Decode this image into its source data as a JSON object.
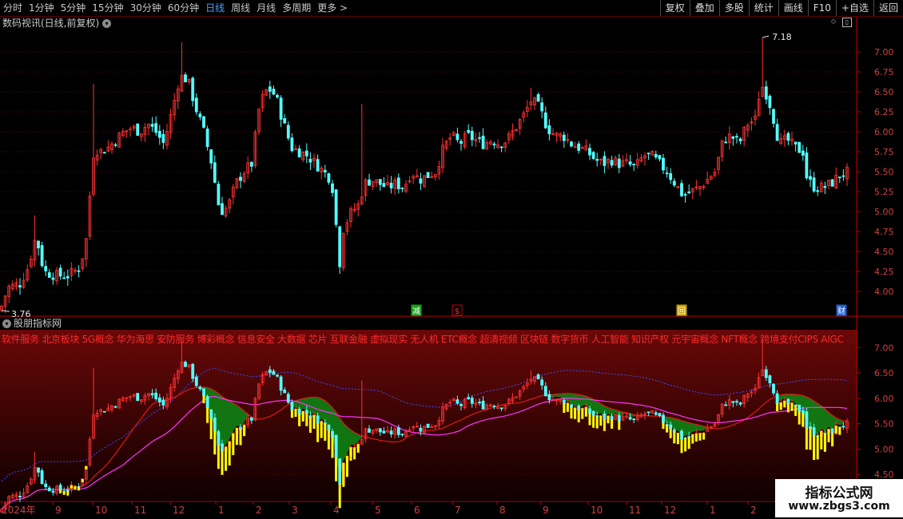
{
  "toolbar": {
    "periods": [
      "分时",
      "1分钟",
      "5分钟",
      "15分钟",
      "30分钟",
      "60分钟",
      "日线",
      "周线",
      "月线",
      "多周期",
      "更多 >"
    ],
    "active_period": "日线",
    "tools": [
      "复权",
      "叠加",
      "多股",
      "统计",
      "画线",
      "F10",
      "+自选",
      "返回"
    ]
  },
  "panel1": {
    "title": "数码视讯(日线,前复权)",
    "high_label": "7.18",
    "low_label": "3.76",
    "event_markers": [
      "减",
      "$",
      "回",
      "财"
    ]
  },
  "panel2": {
    "title": "股朋指标网",
    "concepts": "软件服务 北京板块 5G概念 华为海思 安防服务 博彩概念 信息安全 大数据 芯片 互联金融 虚拟现实 无人机 ETC概念 超清视频 区块链 数字货币 人工智能 知识产权 元宇宙概念 NFT概念 跨境支付CIPS AIGC"
  },
  "watermark": {
    "line1": "指标公式网",
    "line2": "www.zbgs3.com"
  },
  "colors": {
    "up": "#ff3232",
    "down": "#54ffff",
    "ma_red": "#dd1818",
    "ma_magenta": "#ff33ff",
    "upper_band": "#3a4cff",
    "green_fill": "#0a8a14",
    "yellow": "#ffff00",
    "grid": "#6e0000",
    "axis": "#c00000"
  },
  "chart_data": {
    "type": "candlestick",
    "price_axis_top": {
      "ticks": [
        "7.00",
        "6.75",
        "6.50",
        "6.25",
        "6.00",
        "5.75",
        "5.50",
        "5.25",
        "5.00",
        "4.75",
        "4.50",
        "4.25",
        "4.00"
      ],
      "ylim": [
        3.72,
        7.25
      ]
    },
    "price_axis_bottom": {
      "ticks": [
        "7.00",
        "6.50",
        "6.00",
        "5.50",
        "5.00",
        "4.50"
      ],
      "ylim": [
        4.0,
        7.35
      ]
    },
    "time_axis": {
      "labels": [
        "2024年",
        "9",
        "10",
        "11",
        "12",
        "1",
        "2",
        "3",
        "4",
        "5",
        "6",
        "7",
        "8",
        "9",
        "10",
        "11",
        "12",
        "1",
        "2"
      ]
    },
    "close_path": [
      [
        0,
        3.76
      ],
      [
        10,
        4.05
      ],
      [
        25,
        4.1
      ],
      [
        35,
        4.3
      ],
      [
        45,
        4.7
      ],
      [
        55,
        4.25
      ],
      [
        70,
        4.2
      ],
      [
        85,
        4.2
      ],
      [
        100,
        4.3
      ],
      [
        110,
        4.75
      ],
      [
        114,
        5.5
      ],
      [
        118,
        5.8
      ],
      [
        125,
        5.75
      ],
      [
        135,
        5.8
      ],
      [
        145,
        5.9
      ],
      [
        155,
        6.0
      ],
      [
        165,
        6.05
      ],
      [
        175,
        6.0
      ],
      [
        185,
        6.1
      ],
      [
        195,
        6.0
      ],
      [
        205,
        5.85
      ],
      [
        215,
        6.25
      ],
      [
        225,
        6.7
      ],
      [
        235,
        6.65
      ],
      [
        245,
        6.3
      ],
      [
        255,
        6.0
      ],
      [
        265,
        5.6
      ],
      [
        275,
        5.0
      ],
      [
        285,
        5.05
      ],
      [
        295,
        5.35
      ],
      [
        305,
        5.5
      ],
      [
        315,
        5.6
      ],
      [
        325,
        6.35
      ],
      [
        335,
        6.55
      ],
      [
        345,
        6.45
      ],
      [
        355,
        6.1
      ],
      [
        365,
        5.8
      ],
      [
        375,
        5.75
      ],
      [
        385,
        5.7
      ],
      [
        395,
        5.6
      ],
      [
        405,
        5.5
      ],
      [
        415,
        5.4
      ],
      [
        420,
        4.9
      ],
      [
        425,
        4.35
      ],
      [
        430,
        4.8
      ],
      [
        440,
        5.0
      ],
      [
        450,
        5.1
      ],
      [
        455,
        5.35
      ],
      [
        465,
        5.4
      ],
      [
        475,
        5.35
      ],
      [
        485,
        5.3
      ],
      [
        495,
        5.35
      ],
      [
        505,
        5.3
      ],
      [
        515,
        5.5
      ],
      [
        525,
        5.4
      ],
      [
        535,
        5.45
      ],
      [
        545,
        5.5
      ],
      [
        555,
        5.8
      ],
      [
        565,
        5.95
      ],
      [
        575,
        5.85
      ],
      [
        585,
        5.95
      ],
      [
        595,
        5.9
      ],
      [
        605,
        5.85
      ],
      [
        615,
        5.9
      ],
      [
        625,
        5.85
      ],
      [
        635,
        5.9
      ],
      [
        645,
        6.05
      ],
      [
        655,
        6.2
      ],
      [
        665,
        6.4
      ],
      [
        675,
        6.3
      ],
      [
        685,
        6.05
      ],
      [
        695,
        5.95
      ],
      [
        705,
        5.95
      ],
      [
        715,
        5.85
      ],
      [
        725,
        5.8
      ],
      [
        735,
        5.75
      ],
      [
        745,
        5.65
      ],
      [
        755,
        5.6
      ],
      [
        765,
        5.65
      ],
      [
        775,
        5.6
      ],
      [
        785,
        5.6
      ],
      [
        795,
        5.55
      ],
      [
        805,
        5.7
      ],
      [
        815,
        5.7
      ],
      [
        825,
        5.6
      ],
      [
        835,
        5.5
      ],
      [
        845,
        5.35
      ],
      [
        855,
        5.2
      ],
      [
        865,
        5.25
      ],
      [
        875,
        5.3
      ],
      [
        885,
        5.4
      ],
      [
        895,
        5.5
      ],
      [
        905,
        5.9
      ],
      [
        915,
        5.95
      ],
      [
        925,
        5.85
      ],
      [
        935,
        6.1
      ],
      [
        945,
        6.15
      ],
      [
        952,
        6.6
      ],
      [
        958,
        6.5
      ],
      [
        965,
        6.3
      ],
      [
        975,
        5.85
      ],
      [
        985,
        5.9
      ],
      [
        995,
        5.8
      ],
      [
        1005,
        5.75
      ],
      [
        1010,
        5.4
      ],
      [
        1020,
        5.3
      ],
      [
        1030,
        5.3
      ],
      [
        1040,
        5.35
      ],
      [
        1050,
        5.45
      ],
      [
        1062,
        5.5
      ]
    ]
  }
}
